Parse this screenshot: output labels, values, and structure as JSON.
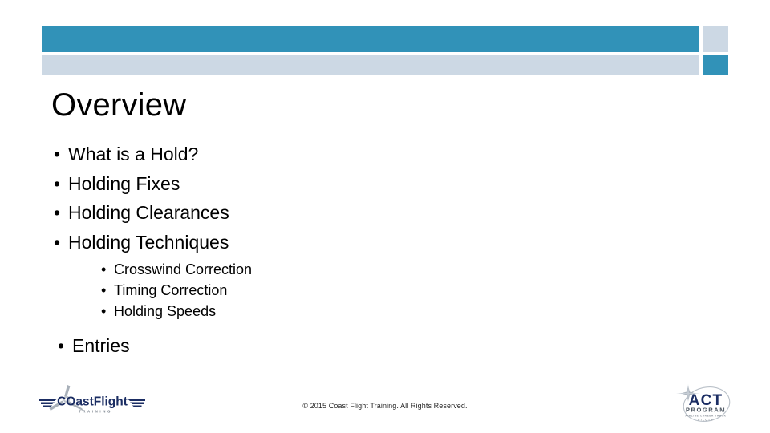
{
  "slide": {
    "title": "Overview",
    "theme": {
      "accent_blue": "#3192b8",
      "accent_light": "#ccd8e4",
      "text_color": "#000000",
      "background": "#ffffff"
    }
  },
  "bullets": {
    "glyph": "•",
    "level1": [
      {
        "label": "What is a Hold?"
      },
      {
        "label": "Holding Fixes"
      },
      {
        "label": "Holding Clearances"
      },
      {
        "label": "Holding Techniques"
      }
    ],
    "level2": [
      {
        "label": "Crosswind Correction"
      },
      {
        "label": "Timing Correction"
      },
      {
        "label": "Holding Speeds"
      }
    ],
    "trailing": [
      {
        "label": "Entries"
      }
    ]
  },
  "footer": {
    "copyright": "© 2015 Coast Flight Training. All Rights Reserved."
  },
  "logos": {
    "left": {
      "name": "coast-flight-training-logo",
      "wordmark": "COastFlight",
      "tagline": "T R A I N I N G"
    },
    "right": {
      "name": "act-program-logo",
      "wordmark": "ACT",
      "subtitle": "PROGRAM",
      "tagline": "AIRLINE CAREER TRACK",
      "tagline2": "PILOTS"
    }
  }
}
